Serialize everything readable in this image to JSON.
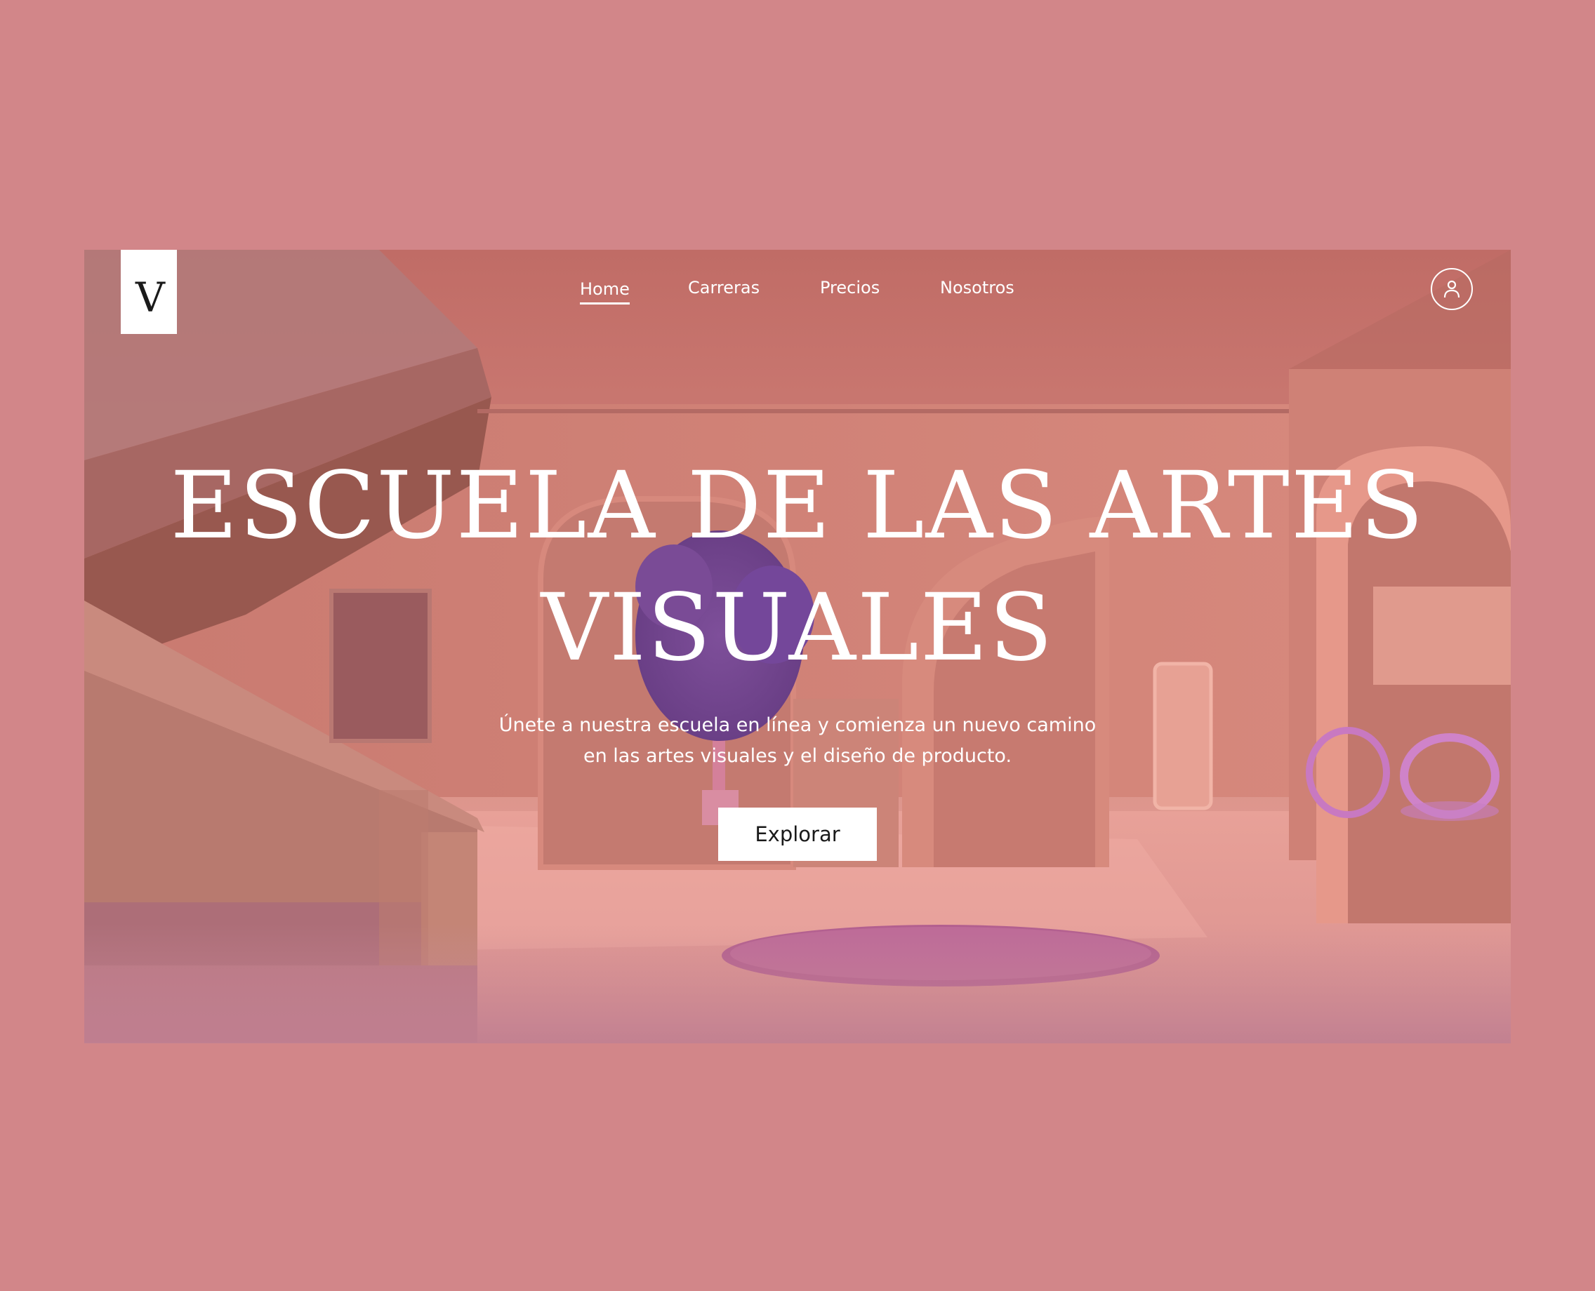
{
  "brand": {
    "logo_letter": "V"
  },
  "nav": {
    "items": [
      {
        "label": "Home",
        "active": true
      },
      {
        "label": "Carreras",
        "active": false
      },
      {
        "label": "Precios",
        "active": false
      },
      {
        "label": "Nosotros",
        "active": false
      }
    ],
    "user_icon": "user-icon"
  },
  "hero": {
    "title_line1": "ESCUELA DE LAS ARTES",
    "title_line2": "VISUALES",
    "subtitle_line1": "Únete a nuestra escuela en línea y comienza un nuevo camino",
    "subtitle_line2": "en las artes visuales y el diseño de producto.",
    "cta_label": "Explorar"
  },
  "colors": {
    "page_background": "#d28689",
    "accent_text": "#ffffff",
    "button_background": "#ffffff",
    "button_text": "#1a1a1a"
  }
}
